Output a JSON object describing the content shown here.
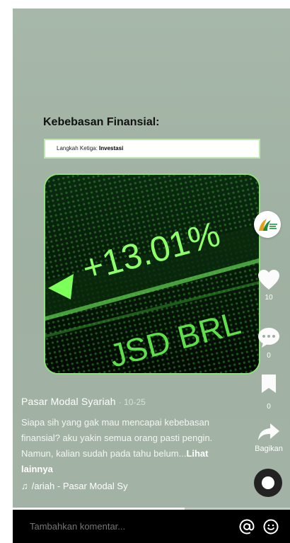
{
  "video": {
    "title": "Kebebasan Finansial:",
    "step_prefix": "Langkah Ketiga: ",
    "step_bold": "Investasi",
    "ticker_value": "+13.01%",
    "ticker_lower": "JSD BRL",
    "accent_color": "#7dff5a"
  },
  "rail": {
    "like_count": "10",
    "comment_count": "0",
    "bookmark_count": "0",
    "share_label": "Bagikan",
    "avatar_logo_text": "PASAR MODAL SYARIAH"
  },
  "meta": {
    "author": "Pasar Modal Syariah",
    "date": "· 10-25",
    "caption": "Siapa sih yang gak mau mencapai kebebasan finansial? aku yakin semua orang pasti pengin. Namun, kalian sudah pada tahu belum...",
    "see_more": "Lihat lainnya",
    "music_text": "/ariah - Pasar Modal Sy"
  },
  "playback": {
    "progress_fraction": 0.62
  },
  "comment": {
    "placeholder": "Tambahkan komentar..."
  },
  "icons": {
    "like": "heart-icon",
    "comment": "comment-bubble-icon",
    "bookmark": "bookmark-icon",
    "share": "share-arrow-icon",
    "mention": "at-icon",
    "emoji": "emoji-icon",
    "music": "music-note-icon"
  }
}
